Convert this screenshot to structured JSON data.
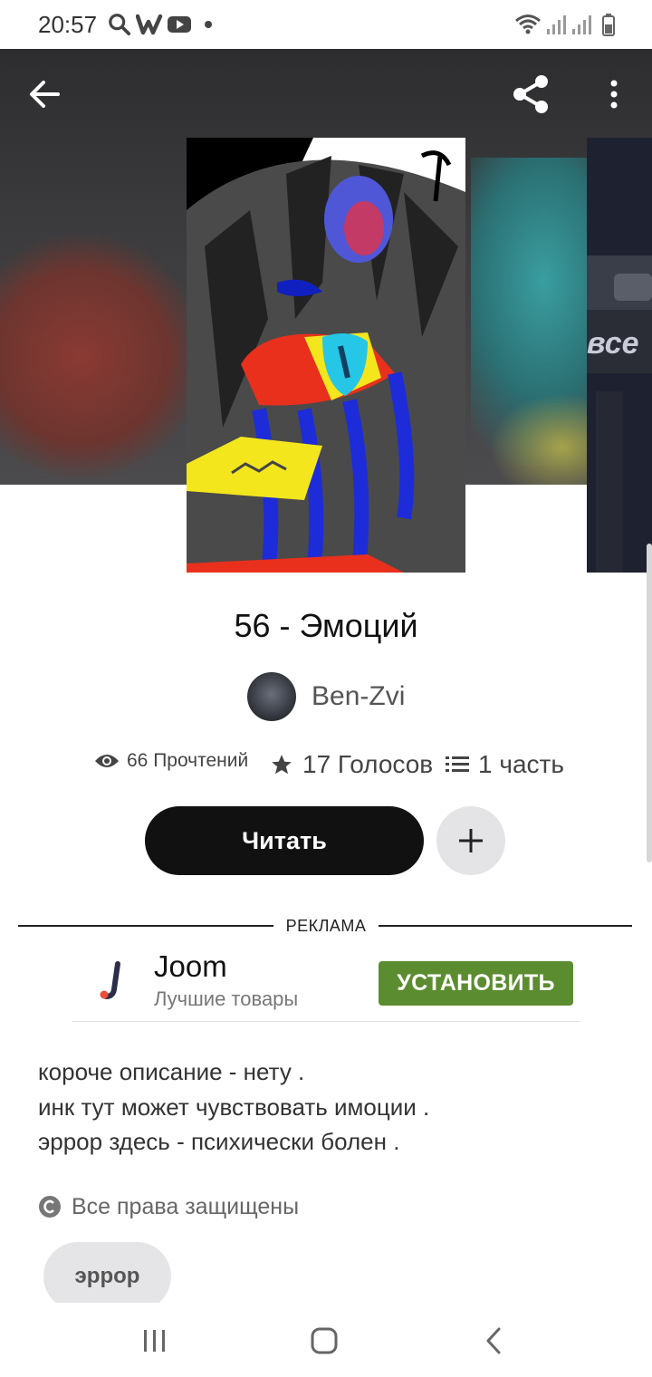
{
  "status_bar": {
    "time": "20:57",
    "left_icons": [
      "search-icon",
      "wattpad-icon",
      "youtube-icon",
      "dot-icon"
    ],
    "right_icons": [
      "wifi-icon",
      "signal-icon",
      "signal-icon",
      "battery-icon"
    ]
  },
  "header": {
    "icons": [
      "back-arrow-icon",
      "share-icon",
      "more-vertical-icon"
    ]
  },
  "story": {
    "title": "56 - Эмоций",
    "author": "Ben-Zvi",
    "stats": {
      "reads": "66 Прочтений",
      "votes": "17 Голосов",
      "parts": "1 часть"
    },
    "read_button": "Читать",
    "add_button_icon": "plus-icon",
    "description": [
      "короче описание - нету .",
      "инк тут может чувствовать имоции .",
      "эррор здесь - психически болен ."
    ],
    "copyright": "Все права защищены",
    "tag": "эррор"
  },
  "ad": {
    "label": "РЕКЛАМА",
    "app_name": "Joom",
    "app_desc": "Лучшие товары",
    "install_label": "УСТАНОВИТЬ",
    "install_color": "#5c8c30"
  },
  "nav_bar": {
    "icons": [
      "recents-icon",
      "home-icon",
      "back-icon"
    ]
  }
}
